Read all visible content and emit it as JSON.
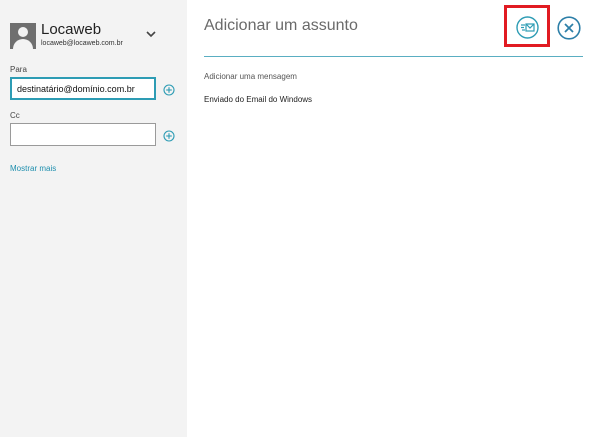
{
  "account": {
    "name": "Locaweb",
    "email": "locaweb@locaweb.com.br",
    "switch_icon": "chevron-down-icon"
  },
  "recipients": {
    "to_label": "Para",
    "to_value": "destinatário@domínio.com.br",
    "cc_label": "Cc",
    "cc_value": "",
    "add_icon": "plus-circle-icon",
    "show_more": "Mostrar mais"
  },
  "compose": {
    "subject_placeholder": "Adicionar um assunto",
    "message_placeholder": "Adicionar uma mensagem",
    "signature": "Enviado do Email do Windows"
  },
  "actions": {
    "send_icon": "send-icon",
    "close_icon": "close-icon"
  },
  "colors": {
    "accent": "#2d9cb4",
    "link": "#1f8fae",
    "highlight": "#e11b22",
    "sidebar_bg": "#f3f3f3"
  }
}
